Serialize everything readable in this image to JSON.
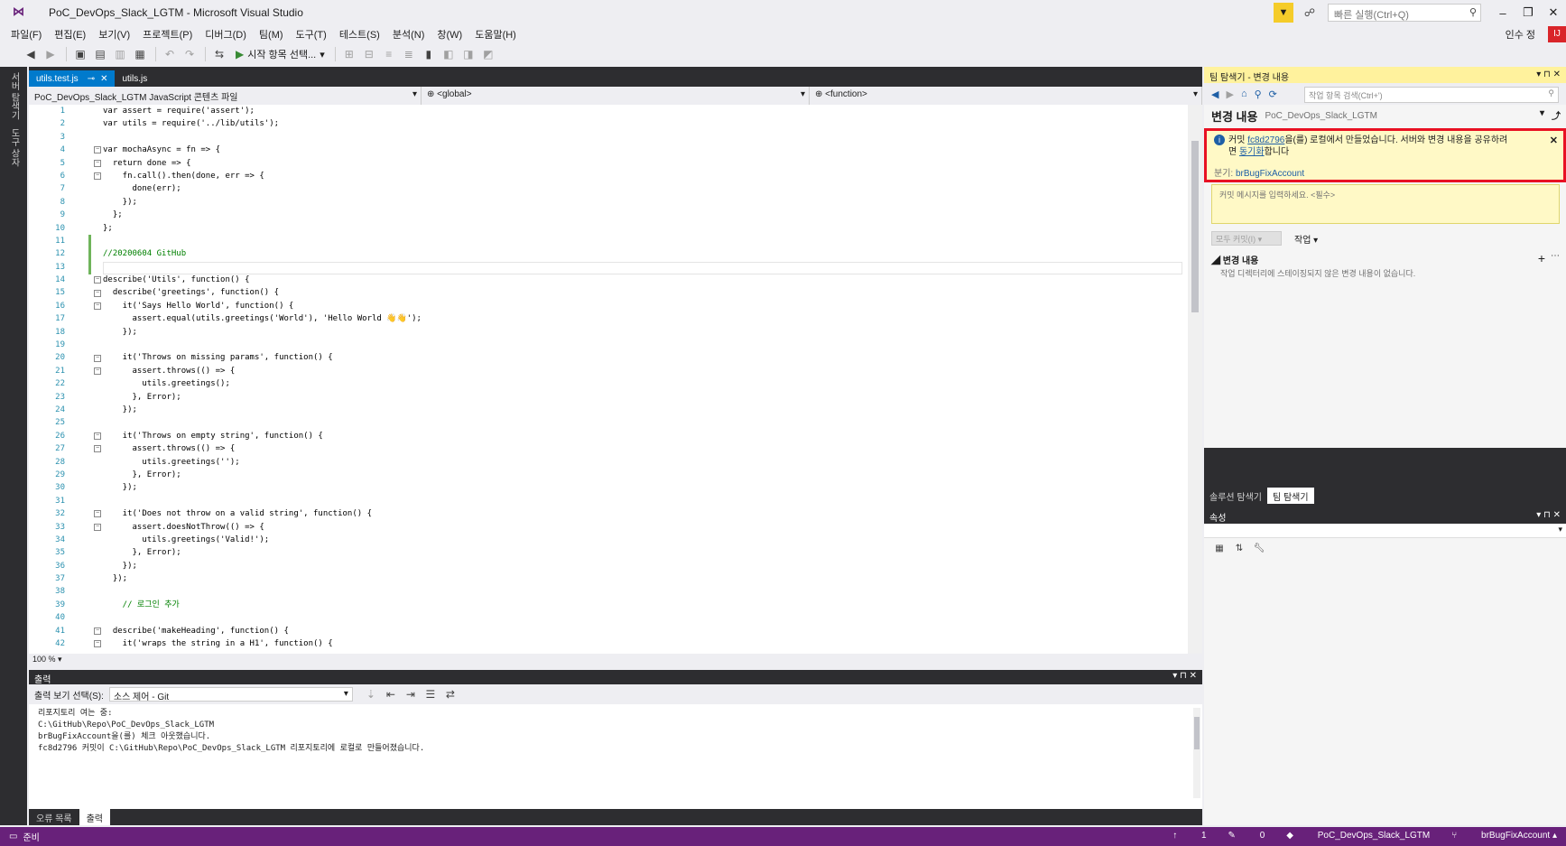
{
  "window": {
    "title": "PoC_DevOps_Slack_LGTM - Microsoft Visual Studio",
    "quick_launch_placeholder": "빠른 실행(Ctrl+Q)",
    "user_name": "인수 정",
    "user_initials": "IJ"
  },
  "menu": [
    "파일(F)",
    "편집(E)",
    "보기(V)",
    "프로젝트(P)",
    "디버그(D)",
    "팀(M)",
    "도구(T)",
    "테스트(S)",
    "분석(N)",
    "창(W)",
    "도움말(H)"
  ],
  "toolbar": {
    "run_label": "시작 항목 선택..."
  },
  "left_strip": {
    "tab1": "서버 탐색기",
    "tab2": "도구 상자"
  },
  "editor": {
    "tabs": [
      {
        "label": "utils.test.js",
        "active": true
      },
      {
        "label": "utils.js",
        "active": false
      }
    ],
    "nav": {
      "project": "PoC_DevOps_Slack_LGTM JavaScript 콘텐츠 파일",
      "scope": "<global>",
      "member": "<function>"
    },
    "line_numbers": [
      "1",
      "2",
      "3",
      "4",
      "5",
      "6",
      "7",
      "8",
      "9",
      "10",
      "11",
      "12",
      "13",
      "14",
      "15",
      "16",
      "17",
      "18",
      "19",
      "20",
      "21",
      "22",
      "23",
      "24",
      "25",
      "26",
      "27",
      "28",
      "29",
      "30",
      "31",
      "32",
      "33",
      "34",
      "35",
      "36",
      "37",
      "38",
      "39",
      "40",
      "41",
      "42"
    ],
    "code": [
      "var assert = require('assert');",
      "var utils = require('../lib/utils');",
      "",
      "var mochaAsync = fn => {",
      "  return done => {",
      "    fn.call().then(done, err => {",
      "      done(err);",
      "    });",
      "  };",
      "};",
      "",
      "//20200604 GitHub",
      "",
      "describe('Utils', function() {",
      "  describe('greetings', function() {",
      "    it('Says Hello World', function() {",
      "      assert.equal(utils.greetings('World'), 'Hello World 👋👋');",
      "    });",
      "",
      "    it('Throws on missing params', function() {",
      "      assert.throws(() => {",
      "        utils.greetings();",
      "      }, Error);",
      "    });",
      "",
      "    it('Throws on empty string', function() {",
      "      assert.throws(() => {",
      "        utils.greetings('');",
      "      }, Error);",
      "    });",
      "",
      "    it('Does not throw on a valid string', function() {",
      "      assert.doesNotThrow(() => {",
      "        utils.greetings('Valid!');",
      "      }, Error);",
      "    });",
      "  });",
      "",
      "    // 로그인 추가",
      "",
      "  describe('makeHeading', function() {",
      "    it('wraps the string in a H1', function() {"
    ],
    "zoom": "100 %"
  },
  "output": {
    "title": "출력",
    "source_label": "출력 보기 선택(S):",
    "source_value": "소스 제어 - Git",
    "lines": [
      "리포지토리 여는 중:",
      "C:\\GitHub\\Repo\\PoC_DevOps_Slack_LGTM",
      "brBugFixAccount을(를) 체크 아웃했습니다.",
      "fc8d2796 커밋이 C:\\GitHub\\Repo\\PoC_DevOps_Slack_LGTM 리포지토리에 로컬로 만들어졌습니다."
    ],
    "tabs": [
      {
        "label": "오류 목록",
        "active": false
      },
      {
        "label": "출력",
        "active": true
      }
    ]
  },
  "team_explorer": {
    "header": "팀 탐색기 - 변경 내용",
    "search_placeholder": "작업 항목 검색(Ctrl+')",
    "page_title": "변경 내용",
    "repo": "PoC_DevOps_Slack_LGTM",
    "info": {
      "prefix": "커밋 ",
      "commit_id": "fc8d2796",
      "mid": "을(를) 로컬에서 만들었습니다. 서버와 변경 내용을 공유하려",
      "line2_pre": "면 ",
      "sync_link": "동기화",
      "line2_post": "합니다",
      "branch_label": "분기: ",
      "branch": "brBugFixAccount"
    },
    "commit_placeholder": "커밋 메시지를 입력하세요. <필수>",
    "commit_all": "모두 커밋(I)",
    "actions": "작업",
    "changes_header": "변경 내용",
    "changes_empty": "작업 디렉터리에 스테이징되지 않은 변경 내용이 없습니다.",
    "bottom_tabs": [
      {
        "label": "솔루션 탐색기",
        "active": false
      },
      {
        "label": "팀 탐색기",
        "active": true
      }
    ]
  },
  "properties": {
    "title": "속성"
  },
  "status": {
    "left": "준비",
    "up_count": "1",
    "pending": "0",
    "repo": "PoC_DevOps_Slack_LGTM",
    "branch": "brBugFixAccount"
  },
  "colors": {
    "status_bar": "#68217a",
    "tab_active": "#007acc",
    "highlight_border": "#e81123",
    "info_bg": "#fff9c6"
  }
}
